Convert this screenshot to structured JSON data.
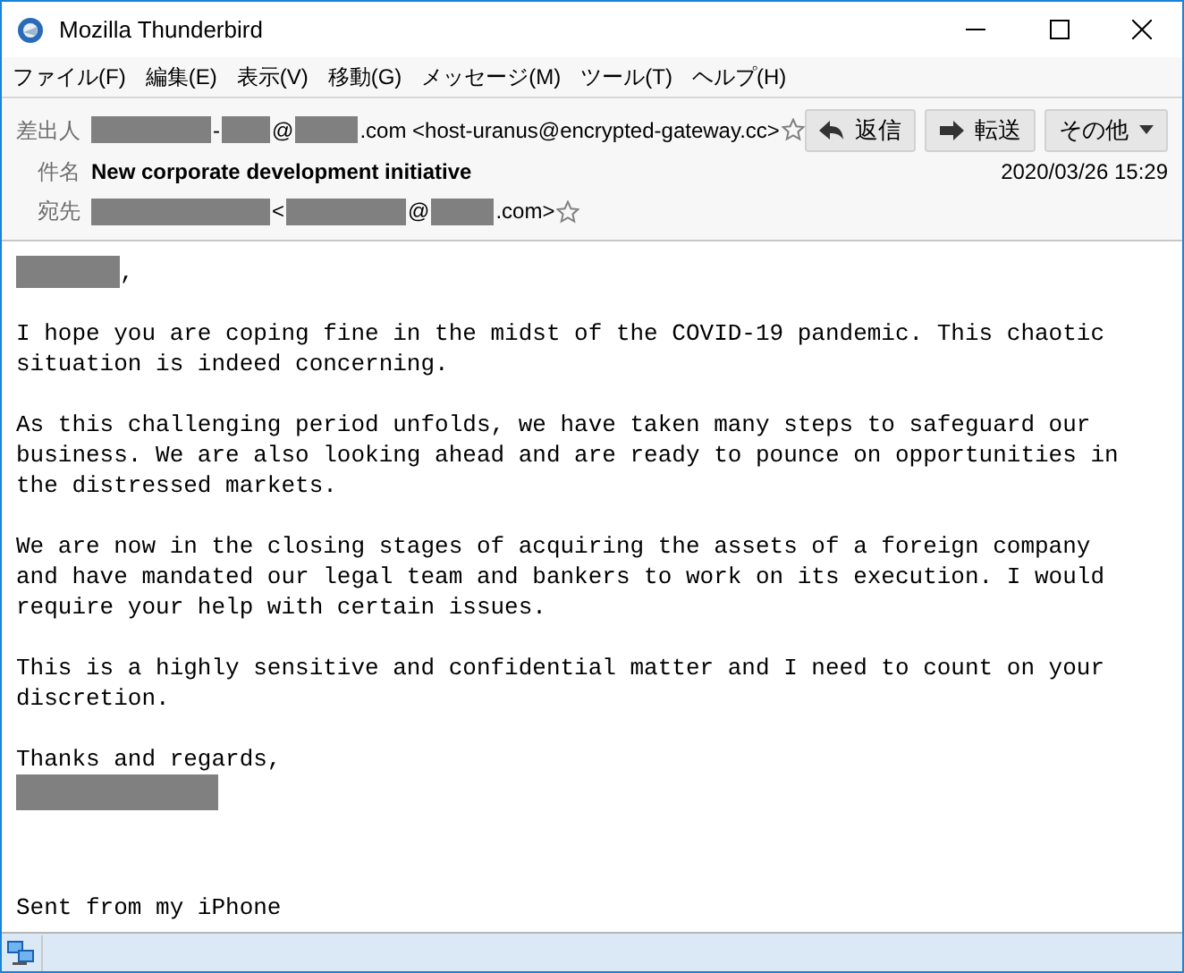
{
  "window": {
    "title": "Mozilla Thunderbird"
  },
  "menu": [
    "ファイル(F)",
    "編集(E)",
    "表示(V)",
    "移動(G)",
    "メッセージ(M)",
    "ツール(T)",
    "ヘルプ(H)"
  ],
  "header": {
    "from": {
      "label": "差出人",
      "parts": [
        {
          "kind": "redacted"
        },
        {
          "kind": "text",
          "text": "-"
        },
        {
          "kind": "redacted"
        },
        {
          "kind": "text",
          "text": "@"
        },
        {
          "kind": "redacted"
        },
        {
          "kind": "text",
          "text": ".com <host-uranus@encrypted-gateway.cc>"
        }
      ]
    },
    "buttons": [
      {
        "label": "返信"
      },
      {
        "label": "転送"
      },
      {
        "label": "その他"
      }
    ],
    "subject": {
      "label": "件名",
      "text": "New corporate development initiative"
    },
    "date": "2020/03/26 15:29",
    "to": {
      "label": "宛先",
      "parts": [
        {
          "kind": "redacted"
        },
        {
          "kind": "text",
          "text": "<"
        },
        {
          "kind": "redacted"
        },
        {
          "kind": "text",
          "text": "@"
        },
        {
          "kind": "redacted"
        },
        {
          "kind": "text",
          "text": ".com>"
        }
      ]
    }
  },
  "body": [
    {
      "kind": "greeting",
      "text": ","
    },
    {
      "kind": "paragraph",
      "lines": [
        "I hope you are coping fine in the midst of the COVID-19 pandemic. This chaotic",
        "situation is indeed concerning."
      ]
    },
    {
      "kind": "paragraph",
      "lines": [
        "As this challenging period unfolds, we have taken many steps to safeguard our",
        "business. We are also looking ahead and are ready to pounce on opportunities in",
        "the distressed markets."
      ]
    },
    {
      "kind": "paragraph",
      "lines": [
        "We are now in the closing stages of acquiring the assets of a foreign company",
        "and have mandated our legal team and bankers to work on its execution. I would",
        "require your help with certain issues."
      ]
    },
    {
      "kind": "paragraph",
      "lines": [
        "This is a highly sensitive and confidential matter and I need to count on your",
        "discretion."
      ]
    },
    {
      "kind": "signoff",
      "text": "Thanks and regards,"
    },
    {
      "kind": "signature",
      "text": "Sent from my iPhone"
    }
  ]
}
